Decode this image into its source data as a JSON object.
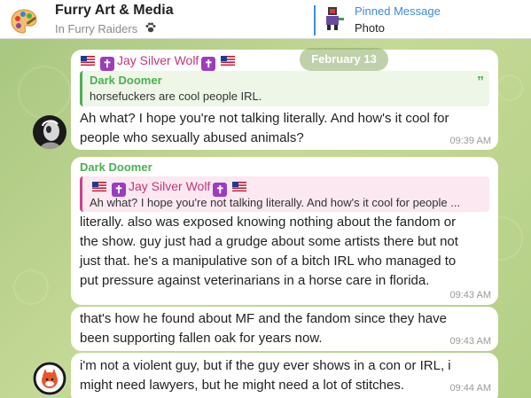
{
  "header": {
    "title": "Furry Art & Media",
    "subtitle": "In Furry Raiders",
    "pinned_label": "Pinned Message",
    "pinned_text": "Photo"
  },
  "date_pill": "February 13",
  "messages": [
    {
      "top_sender": "Jay Silver Wolf",
      "reply": {
        "name": "Dark Doomer",
        "text": "horsefuckers are cool people IRL."
      },
      "lines": [
        "Ah what? I hope you're not talking literally. And how's it cool for",
        "people who sexually abused animals?"
      ],
      "time": "09:39 AM"
    },
    {
      "sender": "Dark Doomer",
      "reply": {
        "name": "Jay Silver Wolf",
        "text": "Ah what? I hope you're not talking literally. And how's it cool for people ..."
      },
      "lines": [
        "literally. also was exposed knowing nothing about the fandom or",
        "the show. guy just had a grudge about some artists there but not",
        "just that. he's a manipulative son of a bitch IRL who managed to",
        "put pressure against veterinarians in a horse care in florida."
      ],
      "time": "09:43 AM"
    },
    {
      "lines": [
        "that's how he found about MF and the fandom since they have",
        "been supporting fallen oak for years now."
      ],
      "time": "09:43 AM"
    },
    {
      "lines": [
        "i'm not a violent guy, but if the guy ever shows in a con or IRL, i",
        "might need lawyers, but he might need a lot of stitches."
      ],
      "time": "09:44 AM"
    }
  ],
  "colors": {
    "accent_blue": "#3f8bd6",
    "sender_green": "#4caf50",
    "sender_pink": "#c2357a",
    "chat_bg": "#b5cf8e"
  }
}
